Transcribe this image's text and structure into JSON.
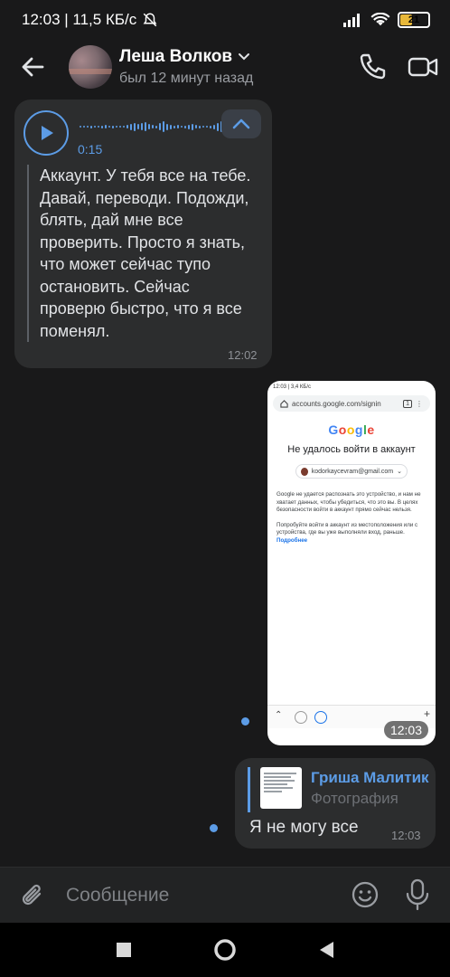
{
  "status_bar": {
    "time_and_speed": "12:03 | 11,5 КБ/с",
    "battery_level": "21",
    "icons": [
      "mute-bell-icon",
      "signal-icon",
      "wifi-icon",
      "battery-icon"
    ]
  },
  "header": {
    "contact_name": "Леша Волков",
    "status": "был 12 минут назад",
    "icons": [
      "back-arrow-icon",
      "chevron-down-icon",
      "phone-icon",
      "video-call-icon"
    ]
  },
  "voice_message": {
    "duration": "0:15",
    "transcript": "Аккаунт. У тебя все на тебе. Давай, переводи. Подожди, блять, дай мне все проверить. Просто я знать, что может сейчас тупо остановить. Сейчас проверю быстро, что я все поменял.",
    "time": "12:02"
  },
  "photo_message": {
    "time": "12:03",
    "screenshot": {
      "status": "12:03 | 3,4 КБ/с",
      "url": "accounts.google.com/signin",
      "tab_count": "1",
      "logo": "Google",
      "title": "Не удалось войти в аккаунт",
      "account": "kodorkaycevram@gmail.com",
      "paragraph1": "Google не удается распознать это устройство, и нам не хватает данных, чтобы убедиться, что это вы. В целях безопасности войти в аккаунт прямо сейчас нельзя.",
      "paragraph2": "Попробуйте войти в аккаунт из местоположения или с устройства, где вы уже выполняли вход, раньше.",
      "link": "Подробнее"
    }
  },
  "reply_message": {
    "reply_author": "Гриша Малитик",
    "reply_text": "Фотография",
    "text": "Я не могу все",
    "time": "12:03"
  },
  "composer": {
    "placeholder": "Сообщение",
    "icons": [
      "attach-icon",
      "emoji-icon",
      "microphone-icon"
    ]
  },
  "system_nav": {
    "icons": [
      "recents-square-icon",
      "home-circle-icon",
      "back-triangle-icon"
    ]
  },
  "colors": {
    "background": "#19191a",
    "bubble": "#2c2d2e",
    "accent": "#5c9ce6",
    "text": "#e1e3e6",
    "secondary_text": "#8e9196"
  }
}
